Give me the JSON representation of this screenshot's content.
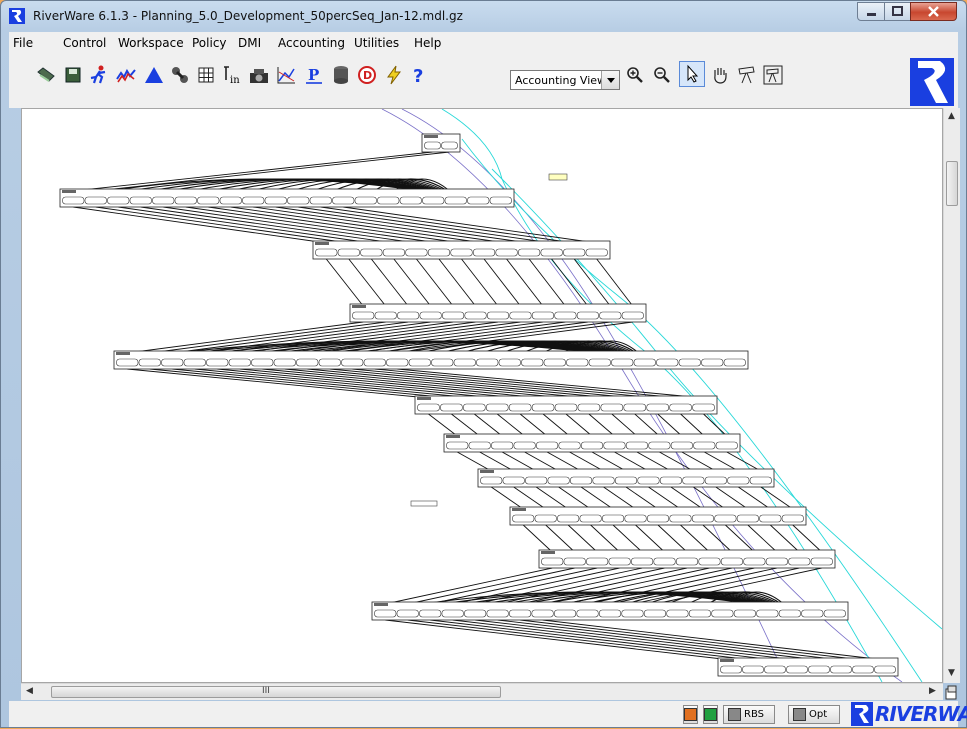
{
  "window": {
    "title": "RiverWare 6.1.3 - Planning_5.0_Development_50percSeq_Jan-12.mdl.gz"
  },
  "menu": [
    "File",
    "Control",
    "Workspace",
    "Policy",
    "DMI",
    "Accounting",
    "Utilities",
    "Help"
  ],
  "toolbar": {
    "view_selected": "Accounting View",
    "icons": [
      "open-folder-icon",
      "save-disk-icon",
      "run-icon",
      "multi-run-icon",
      "triangle-icon",
      "link-icon",
      "grid-icon",
      "tin-icon",
      "snapshot-icon",
      "plot-icon",
      "policy-p-icon",
      "database-icon",
      "dmi-d-icon",
      "lightning-icon",
      "help-icon",
      "zoom-in-icon",
      "zoom-out-icon",
      "pointer-icon",
      "hand-icon",
      "telescope-icon",
      "telescope-frame-icon"
    ]
  },
  "scroll": {
    "grip": "III"
  },
  "status": {
    "rbs_label": "RBS",
    "opt_label": "Opt",
    "brand": "RIVERWARE"
  },
  "colors": {
    "accent": "#1a3fe0",
    "background": "#f0a858",
    "link_cyan": "#28d8d8",
    "link_purple": "#7a70c8"
  }
}
